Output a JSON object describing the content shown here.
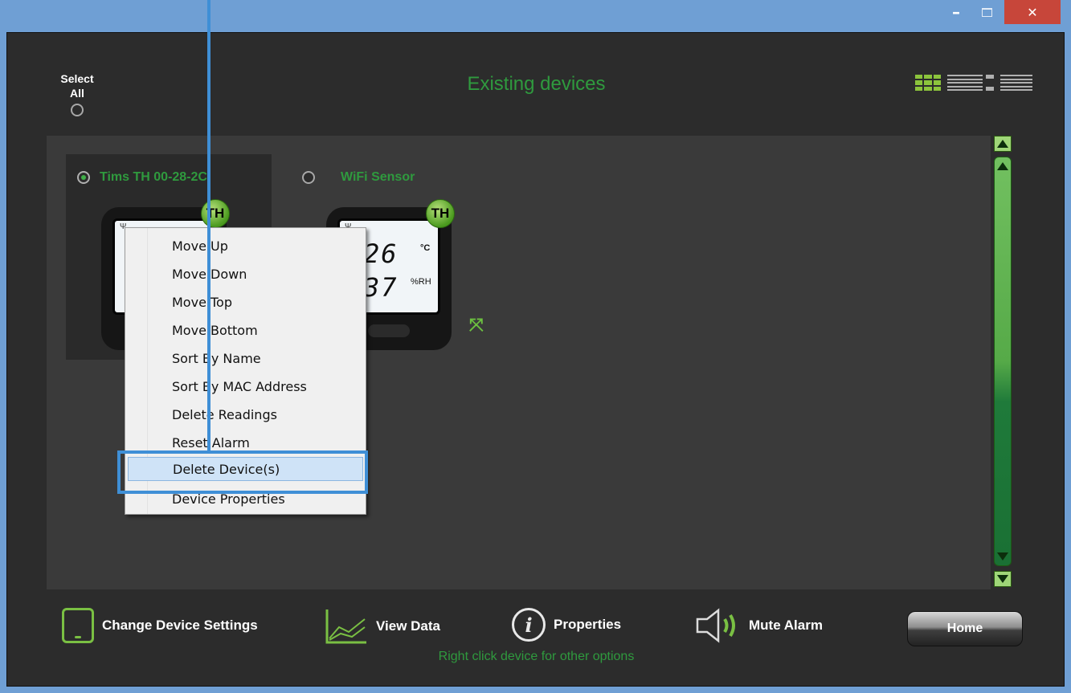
{
  "window": {
    "controls": {
      "minimize": "–",
      "maximize": "□",
      "close": "✕"
    }
  },
  "header": {
    "select_all": {
      "line1": "Select",
      "line2": "All"
    },
    "title": "Existing devices",
    "view_modes": [
      "grid-view",
      "detail-view",
      "list-view"
    ]
  },
  "devices": [
    {
      "name": "Tims TH 00-28-2C",
      "badge": "TH",
      "selected": true
    },
    {
      "name": "WiFi Sensor",
      "badge": "TH",
      "selected": false,
      "temperature": "26",
      "temperature_unit": "°C",
      "humidity": "37",
      "humidity_unit": "%RH"
    }
  ],
  "context_menu": {
    "items": [
      "Move Up",
      "Move Down",
      "Move Top",
      "Move Bottom",
      "Sort By Name",
      "Sort By MAC Address",
      "Delete Readings",
      "Reset Alarm",
      "Delete Device(s)",
      "Device Properties"
    ],
    "highlighted": "Delete Device(s)"
  },
  "toolbar": {
    "change_settings": "Change Device Settings",
    "view_data": "View Data",
    "properties": "Properties",
    "mute_alarm": "Mute Alarm",
    "home": "Home"
  },
  "hint": "Right click device for other options",
  "colors": {
    "accent_green": "#2f9a3e",
    "title_bar": "#6f9fd4",
    "close_red": "#c7463a",
    "highlight": "#3f8fd6"
  }
}
